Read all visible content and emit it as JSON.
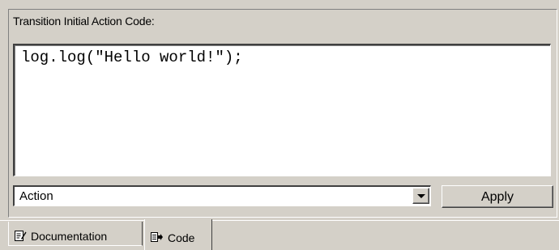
{
  "caption": "Transition Initial Action Code:",
  "editor": {
    "code": "log.log(\"Hello world!\");"
  },
  "combo": {
    "selected": "Action",
    "icon": "chevron-down-icon"
  },
  "apply_label": "Apply",
  "tabs": [
    {
      "label": "Documentation",
      "icon": "documentation-icon",
      "active": false
    },
    {
      "label": "Code",
      "icon": "code-icon",
      "active": true
    }
  ]
}
